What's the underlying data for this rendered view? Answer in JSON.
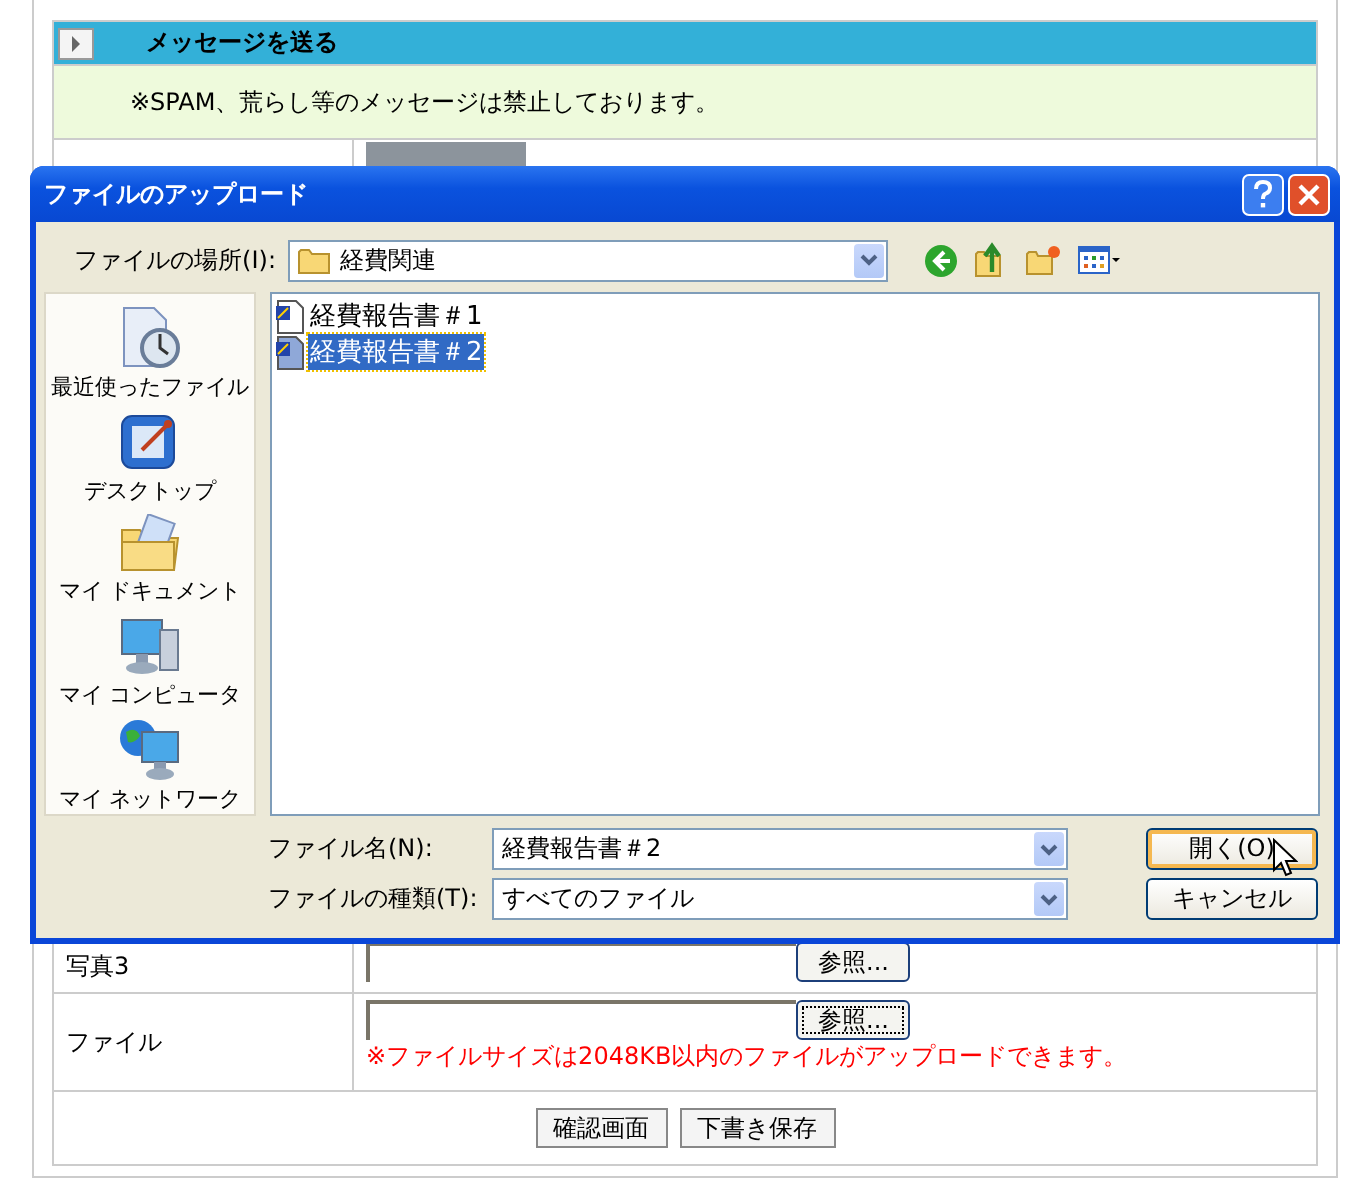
{
  "section": {
    "title": "メッセージを送る",
    "notice": "※SPAM、荒らし等のメッセージは禁止しております。"
  },
  "form": {
    "rows": [
      {
        "kind": "photo"
      },
      {
        "kind": "upload",
        "label": "写真3",
        "browse": "参照..."
      },
      {
        "kind": "upload",
        "label": "ファイル",
        "browse": "参照...",
        "note": "※ファイルサイズは2048KB以内のファイルがアップロードできます。"
      }
    ],
    "buttons": [
      "確認画面",
      "下書き保存"
    ]
  },
  "dialog": {
    "title": "ファイルのアップロード",
    "location_label": "ファイルの場所(I):",
    "location": "経費関連",
    "places": [
      {
        "kind": "recent",
        "label": "最近使ったファイル"
      },
      {
        "kind": "desktop",
        "label": "デスクトップ"
      },
      {
        "kind": "documents",
        "label": "マイ ドキュメント"
      },
      {
        "kind": "computer",
        "label": "マイ コンピュータ"
      },
      {
        "kind": "network",
        "label": "マイ ネットワーク"
      }
    ],
    "files": [
      {
        "name": "経費報告書＃1",
        "selected": false
      },
      {
        "name": "経費報告書＃2",
        "selected": true
      }
    ],
    "filename_label": "ファイル名(N):",
    "filename": "経費報告書＃2",
    "filetype_label": "ファイルの種類(T):",
    "filetype": "すべてのファイル",
    "open": "開く(O)",
    "cancel": "キャンセル"
  }
}
